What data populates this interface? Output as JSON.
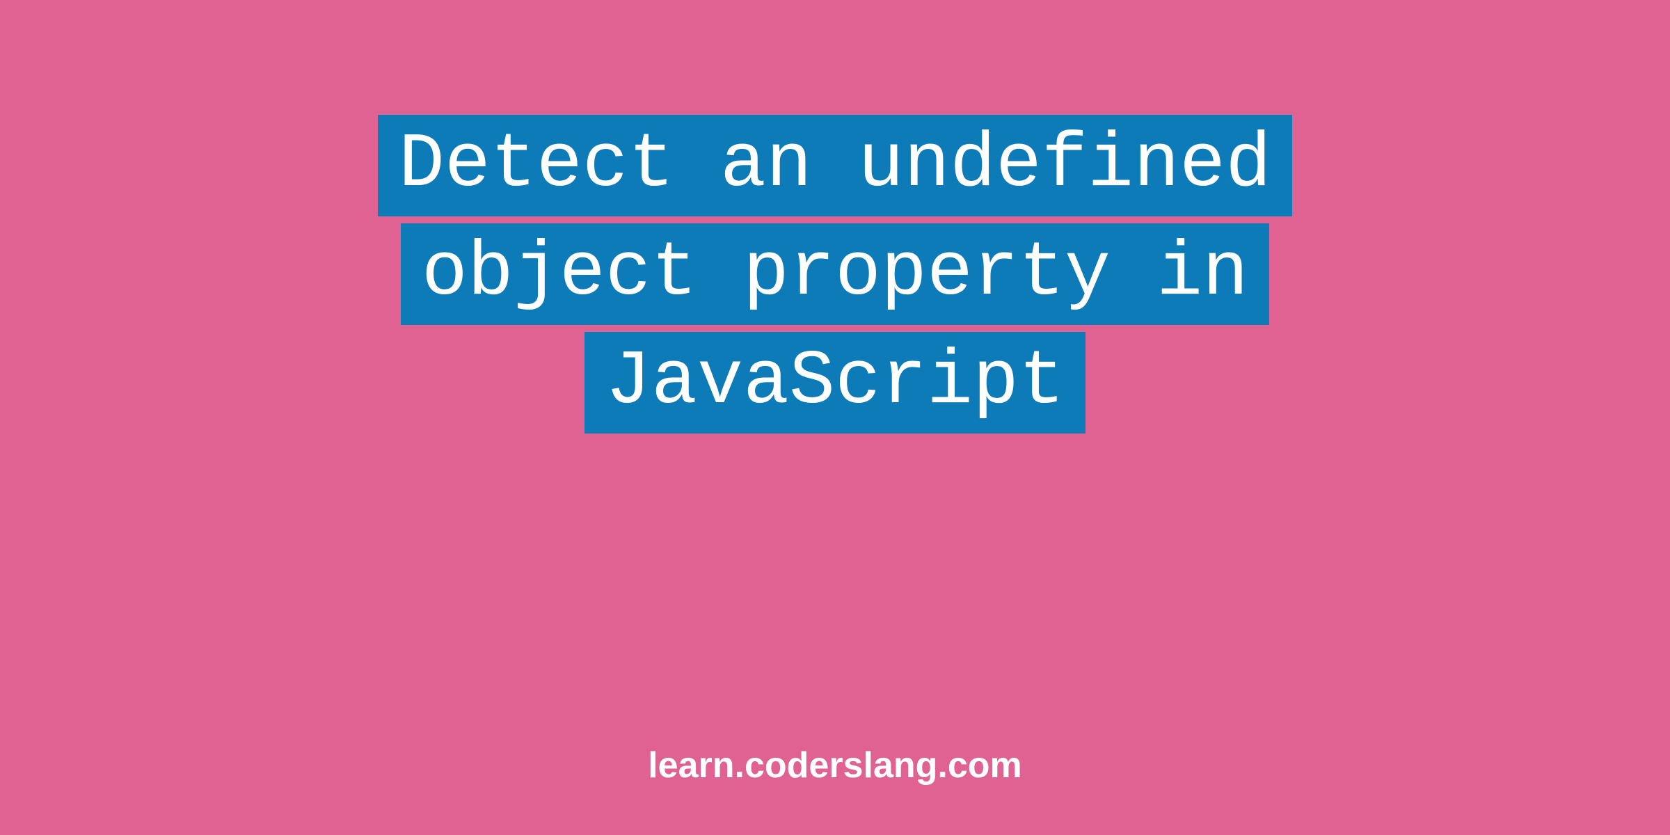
{
  "title": {
    "lines": [
      "Detect an undefined",
      "object property in",
      "JavaScript"
    ]
  },
  "footer": {
    "text": "learn.coderslang.com"
  },
  "colors": {
    "background": "#e06292",
    "highlight": "#0d7bb8",
    "text": "#ffffff"
  }
}
